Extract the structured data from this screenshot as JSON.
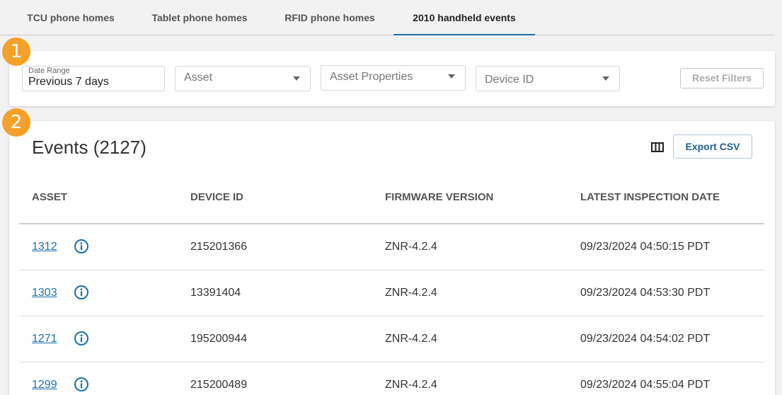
{
  "tabs": [
    {
      "label": "TCU phone homes",
      "active": false
    },
    {
      "label": "Tablet phone homes",
      "active": false
    },
    {
      "label": "RFID phone homes",
      "active": false
    },
    {
      "label": "2010 handheld events",
      "active": true
    }
  ],
  "badges": {
    "filters": "1",
    "events": "2"
  },
  "filters": {
    "date_range": {
      "label": "Date Range",
      "value": "Previous 7 days"
    },
    "asset": {
      "placeholder": "Asset"
    },
    "asset_properties": {
      "placeholder": "Asset Properties"
    },
    "device_id": {
      "placeholder": "Device ID"
    },
    "reset_label": "Reset Filters"
  },
  "events": {
    "title": "Events (2127)",
    "export_label": "Export CSV",
    "columns": [
      "ASSET",
      "DEVICE ID",
      "FIRMWARE VERSION",
      "LATEST INSPECTION DATE"
    ],
    "rows": [
      {
        "asset": "1312",
        "device_id": "215201366",
        "firmware": "ZNR-4.2.4",
        "date": "09/23/2024 04:50:15 PDT"
      },
      {
        "asset": "1303",
        "device_id": "13391404",
        "firmware": "ZNR-4.2.4",
        "date": "09/23/2024 04:53:30 PDT"
      },
      {
        "asset": "1271",
        "device_id": "195200944",
        "firmware": "ZNR-4.2.4",
        "date": "09/23/2024 04:54:02 PDT"
      },
      {
        "asset": "1299",
        "device_id": "215200489",
        "firmware": "ZNR-4.2.4",
        "date": "09/23/2024 04:55:04 PDT"
      }
    ]
  },
  "colors": {
    "accent": "#1f6fa8",
    "badge": "#f4a12b"
  },
  "icons": {
    "columns": "columns-icon",
    "info": "info-icon",
    "dropdown": "chevron-down-icon"
  }
}
